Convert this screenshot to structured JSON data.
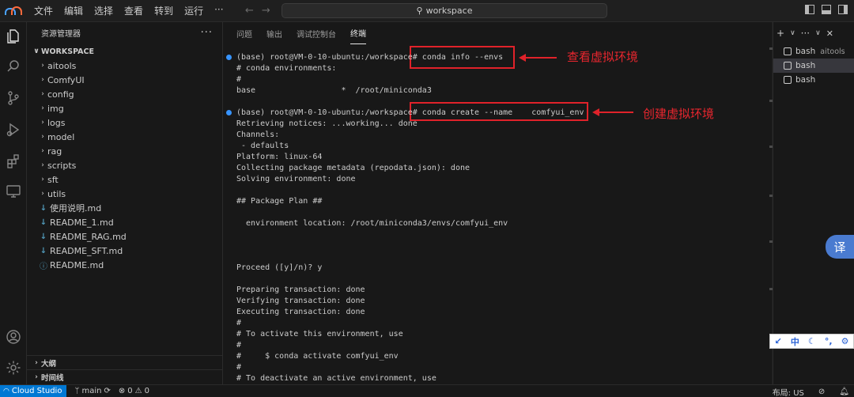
{
  "titlebar": {
    "menu": [
      "文件",
      "编辑",
      "选择",
      "查看",
      "转到",
      "运行",
      "···"
    ],
    "command_center": "workspace"
  },
  "explorer": {
    "title": "资源管理器",
    "more": "···",
    "workspace": "WORKSPACE",
    "folders": [
      "aitools",
      "ComfyUI",
      "config",
      "img",
      "logs",
      "model",
      "rag",
      "scripts",
      "sft",
      "utils"
    ],
    "files": [
      {
        "name": "使用说明.md",
        "icon": "markdown-icon"
      },
      {
        "name": "README_1.md",
        "icon": "markdown-icon"
      },
      {
        "name": "README_RAG.md",
        "icon": "markdown-icon"
      },
      {
        "name": "README_SFT.md",
        "icon": "markdown-icon"
      },
      {
        "name": "README.md",
        "icon": "info-icon"
      }
    ],
    "outline": "大纲",
    "timeline": "时间线"
  },
  "panel": {
    "tabs": [
      "问题",
      "输出",
      "调试控制台",
      "终端"
    ],
    "active_tab": "终端"
  },
  "terminal": {
    "lines": [
      "(base) root@VM-0-10-ubuntu:/workspace# conda info --envs",
      "# conda environments:",
      "#",
      "base                  *  /root/miniconda3",
      "",
      "(base) root@VM-0-10-ubuntu:/workspace# conda create --name    comfyui_env",
      "Retrieving notices: ...working... done",
      "Channels:",
      " - defaults",
      "Platform: linux-64",
      "Collecting package metadata (repodata.json): done",
      "Solving environment: done",
      "",
      "## Package Plan ##",
      "",
      "  environment location: /root/miniconda3/envs/comfyui_env",
      "",
      "",
      "",
      "Proceed ([y]/n)? y",
      "",
      "Preparing transaction: done",
      "Verifying transaction: done",
      "Executing transaction: done",
      "#",
      "# To activate this environment, use",
      "#",
      "#     $ conda activate comfyui_env",
      "#",
      "# To deactivate an active environment, use"
    ],
    "annotations": [
      "查看虚拟环境",
      "创建虚拟环境"
    ]
  },
  "terminals_list": {
    "actions": [
      "+",
      "∨",
      "···",
      "∨",
      "✕"
    ],
    "items": [
      {
        "name": "bash",
        "sub": "aitools"
      },
      {
        "name": "bash",
        "sub": ""
      },
      {
        "name": "bash",
        "sub": ""
      }
    ],
    "selected_index": 1
  },
  "widgets": {
    "translate": "译",
    "ime": [
      "↙",
      "中",
      "☾",
      "°,",
      "⚙"
    ]
  },
  "statusbar": {
    "remote": "Cloud Studio",
    "branch": "main",
    "errors": "0",
    "warnings": "0",
    "layout": "布局: US"
  },
  "colors": {
    "accent": "#0078d4",
    "annotation_red": "#e0222a"
  }
}
